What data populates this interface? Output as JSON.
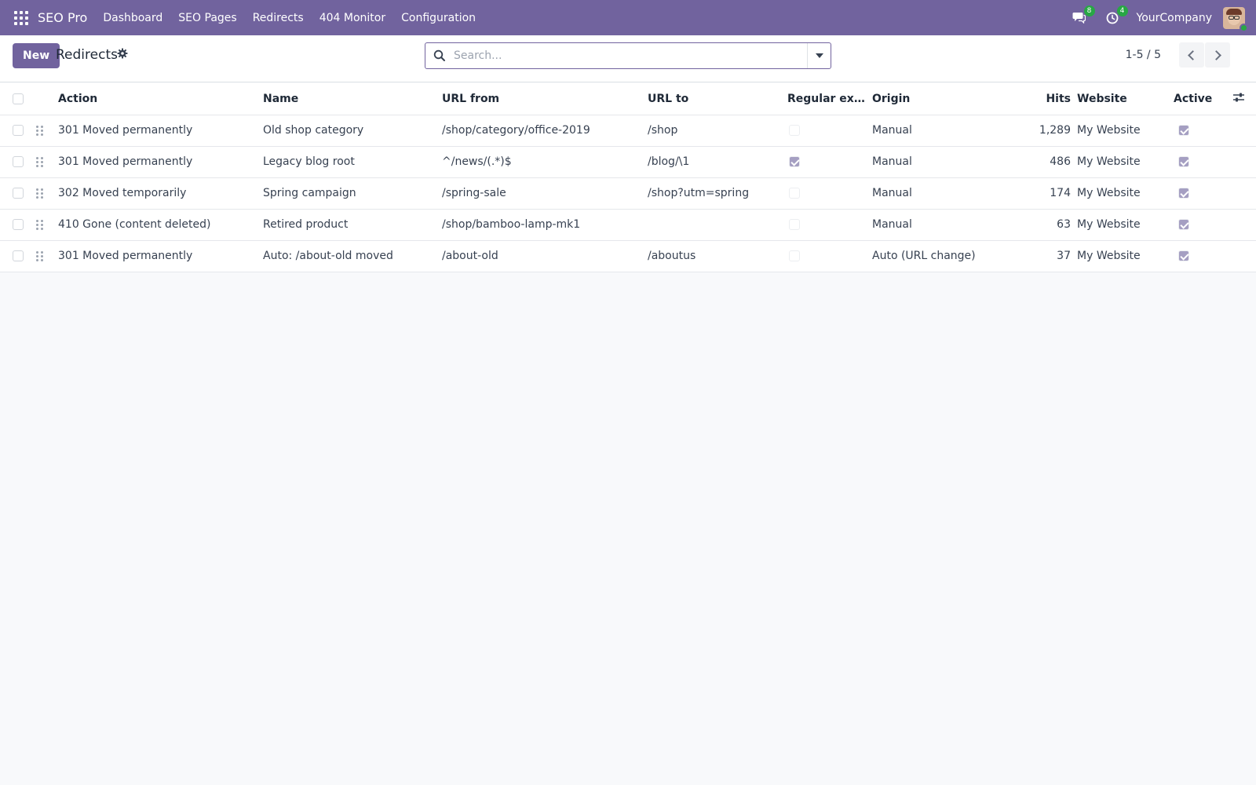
{
  "navbar": {
    "brand": "SEO Pro",
    "menu": [
      "Dashboard",
      "SEO Pages",
      "Redirects",
      "404 Monitor",
      "Configuration"
    ],
    "messages_badge": "8",
    "activities_badge": "4",
    "company": "YourCompany"
  },
  "control": {
    "new_label": "New",
    "title": "Redirects",
    "search_placeholder": "Search...",
    "pager": "1-5 / 5"
  },
  "table": {
    "headers": {
      "action": "Action",
      "name": "Name",
      "url_from": "URL from",
      "url_to": "URL to",
      "regex": "Regular expr…",
      "origin": "Origin",
      "hits": "Hits",
      "website": "Website",
      "active": "Active"
    },
    "rows": [
      {
        "action": "301 Moved permanently",
        "name": "Old shop category",
        "url_from": "/shop/category/office-2019",
        "url_to": "/shop",
        "regex": false,
        "origin": "Manual",
        "hits": "1,289",
        "website": "My Website",
        "active": true
      },
      {
        "action": "301 Moved permanently",
        "name": "Legacy blog root",
        "url_from": "^/news/(.*)$",
        "url_to": "/blog/\\1",
        "regex": true,
        "origin": "Manual",
        "hits": "486",
        "website": "My Website",
        "active": true
      },
      {
        "action": "302 Moved temporarily",
        "name": "Spring campaign",
        "url_from": "/spring-sale",
        "url_to": "/shop?utm=spring",
        "regex": false,
        "origin": "Manual",
        "hits": "174",
        "website": "My Website",
        "active": true
      },
      {
        "action": "410 Gone (content deleted)",
        "name": "Retired product",
        "url_from": "/shop/bamboo-lamp-mk1",
        "url_to": "",
        "regex": false,
        "origin": "Manual",
        "hits": "63",
        "website": "My Website",
        "active": true
      },
      {
        "action": "301 Moved permanently",
        "name": "Auto: /about-old moved",
        "url_from": "/about-old",
        "url_to": "/aboutus",
        "regex": false,
        "origin": "Auto (URL change)",
        "hits": "37",
        "website": "My Website",
        "active": true
      }
    ]
  },
  "colors": {
    "brand": "#71639e",
    "badge": "#28a745",
    "checkbox_checked": "#a59fc2"
  },
  "icons": [
    "apps-grid-icon",
    "chat-icon",
    "activity-clock-icon",
    "gear-icon",
    "search-icon",
    "caret-down-icon",
    "chevron-left-icon",
    "chevron-right-icon",
    "drag-handle-icon",
    "column-settings-icon"
  ]
}
